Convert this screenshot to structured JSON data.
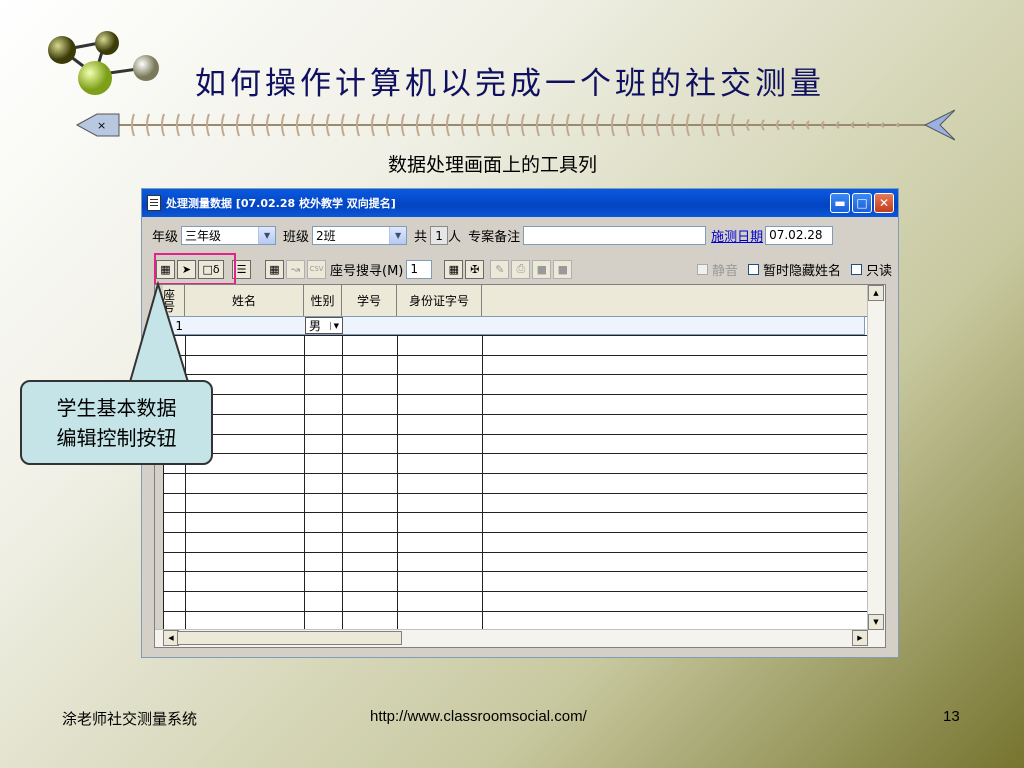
{
  "slide": {
    "title": "如何操作计算机以完成一个班的社交测量",
    "subtitle": "数据处理画面上的工具列",
    "callout_line1": "学生基本数据",
    "callout_line2": "编辑控制按钮",
    "footer_left": "涂老师社交测量系统",
    "footer_url": "http://www.classroomsocial.com/",
    "page_number": "13"
  },
  "window": {
    "title": "处理测量数据 [07.02.28  校外教学  双向提名]",
    "min_icon": "minimize-icon",
    "max_icon": "maximize-icon",
    "close_icon": "close-icon"
  },
  "form": {
    "grade_label": "年级",
    "grade_value": "三年级",
    "class_label": "班级",
    "class_value": "2班",
    "total_prefix": "共",
    "total_count": "1",
    "total_suffix": "人",
    "remarks_label": "专案备注",
    "remarks_value": "",
    "date_link": "施测日期",
    "date_value": "07.02.28"
  },
  "toolbar": {
    "seat_search_label": "座号搜寻(M)",
    "seat_search_value": "1",
    "csv_label": "CSV",
    "mute_label": "静音",
    "hide_names_label": "暂时隐藏姓名",
    "readonly_label": "只读",
    "icons": [
      "grid-icon",
      "arrow-right-icon",
      "doc-search-icon",
      "notes-icon",
      "table-icon",
      "import-icon",
      "csv-icon",
      "table-icon",
      "network-icon",
      "edit-doc-icon",
      "print-icon",
      "export-icon",
      "export2-icon"
    ]
  },
  "table": {
    "columns": [
      "座号",
      "姓名",
      "性别",
      "学号",
      "身份证字号",
      ""
    ],
    "rows": [
      {
        "seat": "1",
        "name": "",
        "gender": "男",
        "student_no": "",
        "id_no": ""
      }
    ]
  },
  "colors": {
    "title_color": "#101060",
    "titlebar": "#0a5adf",
    "highlight": "#e0248a",
    "callout_fill": "#c4e4e8"
  }
}
